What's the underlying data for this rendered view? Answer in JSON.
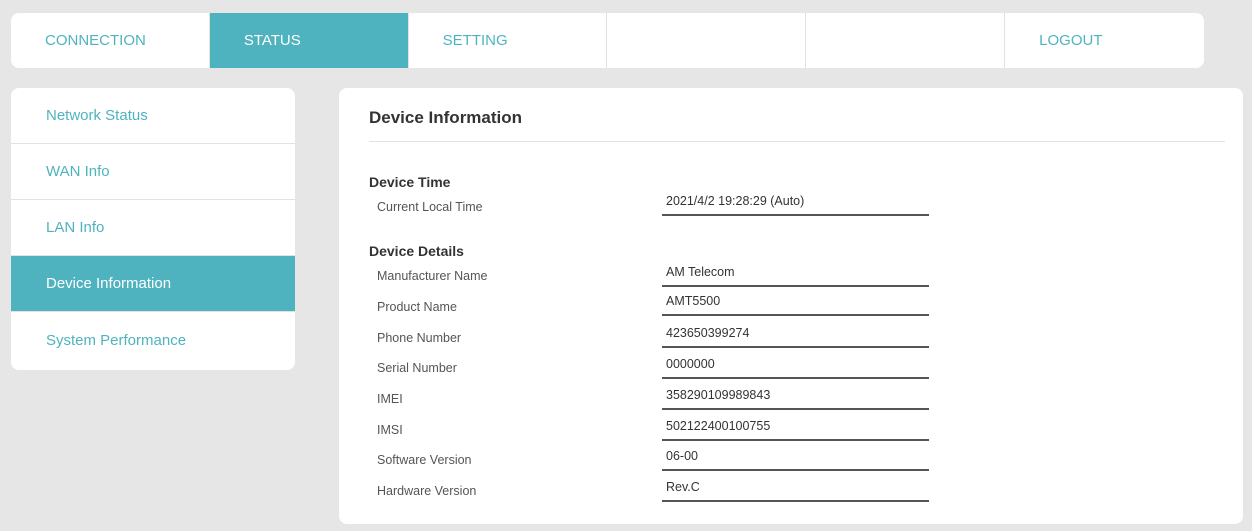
{
  "topnav": {
    "tabs": [
      {
        "label": "CONNECTION"
      },
      {
        "label": "STATUS"
      },
      {
        "label": "SETTING"
      },
      {
        "label": ""
      },
      {
        "label": ""
      },
      {
        "label": "LOGOUT"
      }
    ],
    "active_tab": "STATUS"
  },
  "sidebar": {
    "items": [
      {
        "label": "Network Status"
      },
      {
        "label": "WAN Info"
      },
      {
        "label": "LAN Info"
      },
      {
        "label": "Device Information"
      },
      {
        "label": "System Performance"
      }
    ],
    "active_item": "Device Information"
  },
  "main": {
    "title": "Device Information",
    "device_time": {
      "heading": "Device Time",
      "rows": [
        {
          "label": "Current Local Time",
          "value": "2021/4/2 19:28:29 (Auto)"
        }
      ]
    },
    "device_details": {
      "heading": "Device Details",
      "rows": [
        {
          "label": "Manufacturer Name",
          "value": "AM Telecom"
        },
        {
          "label": "Product Name",
          "value": "AMT5500"
        },
        {
          "label": "Phone Number",
          "value": "423650399274"
        },
        {
          "label": "Serial Number",
          "value": "0000000"
        },
        {
          "label": "IMEI",
          "value": "358290109989843"
        },
        {
          "label": "IMSI",
          "value": "502122400100755"
        },
        {
          "label": "Software Version",
          "value": "06-00"
        },
        {
          "label": "Hardware Version",
          "value": "Rev.C"
        }
      ]
    }
  },
  "colors": {
    "accent": "#4fb3bf",
    "background": "#e6e6e6",
    "panel": "#ffffff"
  }
}
